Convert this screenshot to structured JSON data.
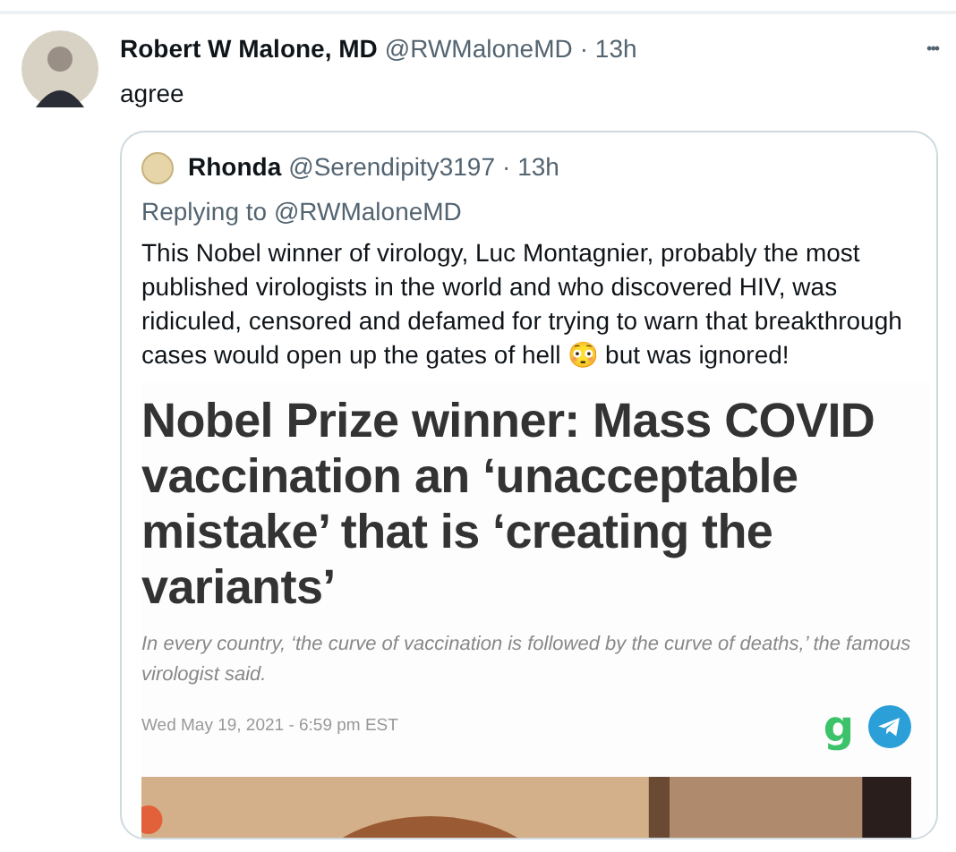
{
  "tweet": {
    "name": "Robert W Malone, MD",
    "handle": "@RWMaloneMD",
    "time": "· 13h",
    "more": "•••",
    "text": "agree",
    "quote": {
      "name": "Rhonda",
      "handle": "@Serendipity3197",
      "time": "· 13h",
      "replying_to": "Replying to",
      "replying_handle": "@RWMaloneMD",
      "text_before": "This Nobel winner of virology, Luc Montagnier, probably the most published virologists in the world and who discovered HIV, was ridiculed, censored and defamed for trying to warn that breakthrough cases would open up the gates of hell 😳 but was ignored!",
      "article": {
        "headline": "Nobel Prize winner: Mass COVID vaccination an ‘unacceptable mistake’ that is ‘creating the variants’",
        "subhead": "In every country, ‘the curve of vaccination is followed by the curve of deaths,’ the famous virologist said.",
        "date": "Wed May 19, 2021 - 6:59 pm EST",
        "logo": "g"
      }
    }
  }
}
